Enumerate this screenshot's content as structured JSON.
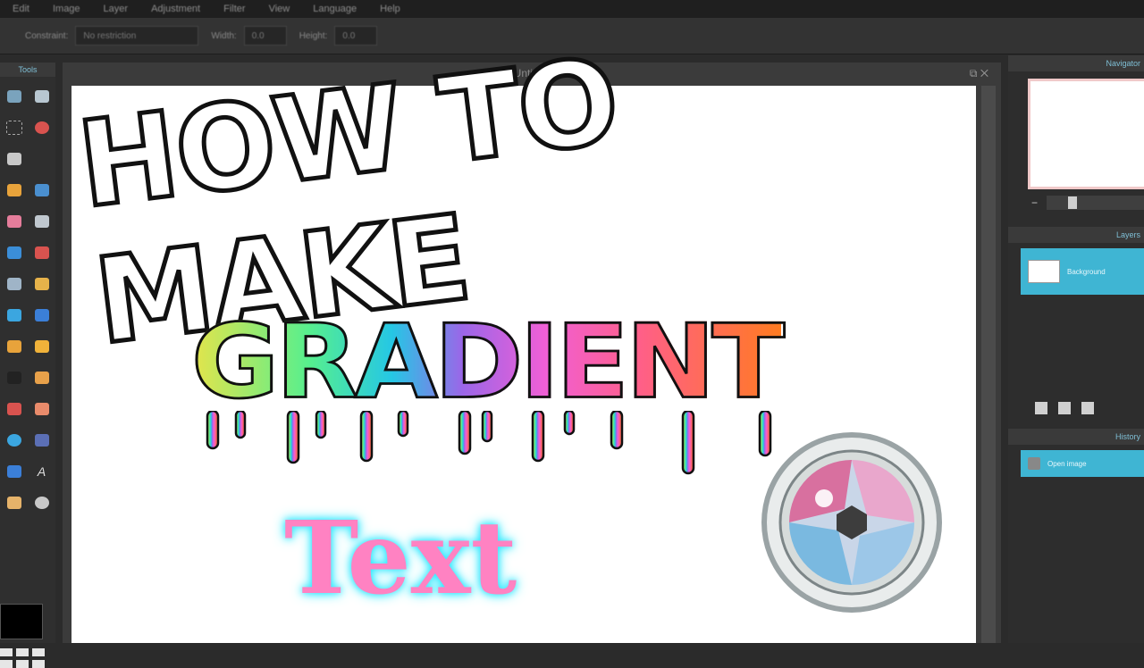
{
  "menubar": {
    "items": [
      "Edit",
      "Image",
      "Layer",
      "Adjustment",
      "Filter",
      "View",
      "Language",
      "Help"
    ]
  },
  "optionsbar": {
    "constraint_label": "Constraint:",
    "constraint_value": "No restriction",
    "width_label": "Width:",
    "width_value": "0.0",
    "height_label": "Height:",
    "height_value": "0.0"
  },
  "tools": {
    "title": "Tools"
  },
  "canvas": {
    "title": "Untitled"
  },
  "navigator": {
    "title": "Navigator"
  },
  "layers": {
    "title": "Layers",
    "layer_name": "Background"
  },
  "history": {
    "title": "History",
    "entry": "Open image"
  },
  "thumbnail_text": {
    "line1": "HOW TO MAKE",
    "line2": "GRADIENT",
    "line3": "Text"
  },
  "colors": {
    "accent": "#3fb5d3",
    "text_pink": "#ff82c2",
    "glow": "#2fe8ff"
  }
}
